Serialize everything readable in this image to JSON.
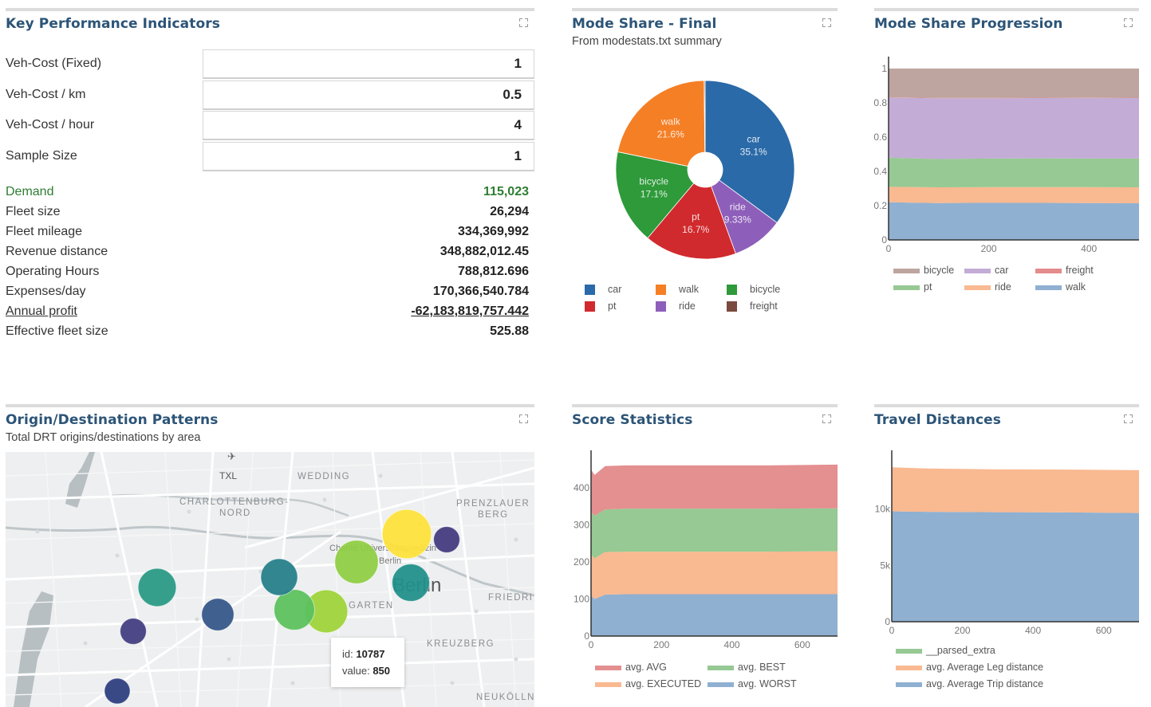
{
  "kpi": {
    "title": "Key Performance Indicators",
    "params": [
      {
        "label": "Veh-Cost (Fixed)",
        "value": "1"
      },
      {
        "label": "Veh-Cost / km",
        "value": "0.5"
      },
      {
        "label": "Veh-Cost / hour",
        "value": "4"
      },
      {
        "label": "Sample Size",
        "value": "1"
      }
    ],
    "metrics": [
      {
        "label": "Demand",
        "value": "115,023",
        "style": "green"
      },
      {
        "label": "Fleet size",
        "value": "26,294",
        "style": ""
      },
      {
        "label": "Fleet mileage",
        "value": "334,369,992",
        "style": ""
      },
      {
        "label": "Revenue distance",
        "value": "348,882,012.45",
        "style": ""
      },
      {
        "label": "Operating Hours",
        "value": "788,812.696",
        "style": ""
      },
      {
        "label": "Expenses/day",
        "value": "170,366,540.784",
        "style": ""
      },
      {
        "label": "Annual profit",
        "value": "-62,183,819,757.442",
        "style": "link"
      },
      {
        "label": "Effective fleet size",
        "value": "525.88",
        "style": ""
      }
    ]
  },
  "od": {
    "title": "Origin/Destination Patterns",
    "subtitle": "Total DRT origins/destinations by area",
    "map_labels": [
      "TXL",
      "WEDDING",
      "CHARLOTTENBURG-",
      "NORD",
      "PRENZLAUER",
      "BERG",
      "Berlin",
      "FRIEDRI",
      "KREUZBERG",
      "NEUKÖLLN",
      "GARTEN",
      "Charité Universitätsmedizin",
      "Berlin"
    ],
    "tooltip": {
      "id_label": "id:",
      "id": "10787",
      "value_label": "value:",
      "value": "850"
    }
  },
  "chart_data": [
    {
      "type": "pie",
      "title": "Mode Share - Final",
      "subtitle": "From modestats.txt summary",
      "slices": [
        {
          "label": "car",
          "value": 35.1,
          "text": "35.1%",
          "color": "#2a6aa8"
        },
        {
          "label": "ride",
          "value": 9.33,
          "text": "9.33%",
          "color": "#8e5fba"
        },
        {
          "label": "pt",
          "value": 16.7,
          "text": "16.7%",
          "color": "#d12a2e"
        },
        {
          "label": "bicycle",
          "value": 17.1,
          "text": "17.1%",
          "color": "#2e9a3a"
        },
        {
          "label": "walk",
          "value": 21.6,
          "text": "21.6%",
          "color": "#f57f25"
        },
        {
          "label": "freight",
          "value": 0.17,
          "text": "",
          "color": "#7b4a3f"
        }
      ],
      "legend": [
        {
          "label": "car",
          "color": "#2a6aa8"
        },
        {
          "label": "walk",
          "color": "#f57f25"
        },
        {
          "label": "bicycle",
          "color": "#2e9a3a"
        },
        {
          "label": "pt",
          "color": "#d12a2e"
        },
        {
          "label": "ride",
          "color": "#8e5fba"
        },
        {
          "label": "freight",
          "color": "#7b4a3f"
        }
      ]
    },
    {
      "type": "area",
      "title": "Mode Share Progression",
      "stacked": true,
      "x": [
        0,
        100,
        200,
        300,
        400,
        500
      ],
      "xlim": [
        0,
        500
      ],
      "ylim": [
        0,
        1
      ],
      "xticks": [
        0,
        200,
        400
      ],
      "yticks": [
        0,
        0.2,
        0.4,
        0.6,
        0.8,
        1
      ],
      "ytick_labels": [
        "0",
        "0.2",
        "0.4",
        "0.6",
        "0.8",
        "1"
      ],
      "series": [
        {
          "name": "walk",
          "color": "#8fb0d1",
          "values": [
            0.22,
            0.215,
            0.217,
            0.216,
            0.215,
            0.214
          ]
        },
        {
          "name": "ride",
          "color": "#f9b991",
          "values": [
            0.09,
            0.092,
            0.091,
            0.092,
            0.093,
            0.093
          ]
        },
        {
          "name": "pt",
          "color": "#96c993",
          "values": [
            0.17,
            0.165,
            0.167,
            0.168,
            0.167,
            0.168
          ]
        },
        {
          "name": "car",
          "color": "#c3acd5",
          "values": [
            0.35,
            0.355,
            0.352,
            0.352,
            0.354,
            0.353
          ]
        },
        {
          "name": "freight",
          "color": "#e48b8c",
          "values": [
            0.002,
            0.002,
            0.002,
            0.002,
            0.002,
            0.002
          ]
        },
        {
          "name": "bicycle",
          "color": "#bea59f",
          "values": [
            0.168,
            0.171,
            0.171,
            0.17,
            0.169,
            0.17
          ]
        }
      ],
      "legend": [
        {
          "label": "bicycle",
          "color": "#bea59f"
        },
        {
          "label": "car",
          "color": "#c3acd5"
        },
        {
          "label": "freight",
          "color": "#e48b8c"
        },
        {
          "label": "pt",
          "color": "#96c993"
        },
        {
          "label": "ride",
          "color": "#f9b991"
        },
        {
          "label": "walk",
          "color": "#8fb0d1"
        }
      ]
    },
    {
      "type": "area",
      "title": "Score Statistics",
      "stacked": true,
      "x": [
        0,
        10,
        40,
        100,
        300,
        500,
        700
      ],
      "xlim": [
        0,
        700
      ],
      "ylim": [
        0,
        480
      ],
      "xticks": [
        0,
        200,
        400,
        600
      ],
      "yticks": [
        0,
        100,
        200,
        300,
        400
      ],
      "ytick_labels": [
        "0",
        "100",
        "200",
        "300",
        "400"
      ],
      "series": [
        {
          "name": "avg. WORST",
          "color": "#8fb0d1",
          "values": [
            110,
            100,
            112,
            113,
            113,
            113,
            113
          ]
        },
        {
          "name": "avg. EXECUTED",
          "color": "#f9b991",
          "values": [
            110,
            110,
            115,
            115,
            115,
            115,
            116
          ]
        },
        {
          "name": "avg. BEST",
          "color": "#96c993",
          "values": [
            115,
            115,
            115,
            116,
            116,
            116,
            116
          ]
        },
        {
          "name": "avg. AVG",
          "color": "#e48f90",
          "values": [
            115,
            110,
            117,
            117,
            117,
            117,
            118
          ]
        }
      ],
      "legend": [
        {
          "label": "avg. AVG",
          "color": "#e48f90"
        },
        {
          "label": "avg. BEST",
          "color": "#96c993"
        },
        {
          "label": "avg. EXECUTED",
          "color": "#f9b991"
        },
        {
          "label": "avg. WORST",
          "color": "#8fb0d1"
        }
      ]
    },
    {
      "type": "area",
      "title": "Travel Distances",
      "stacked": true,
      "x": [
        0,
        100,
        300,
        500,
        700
      ],
      "xlim": [
        0,
        700
      ],
      "ylim": [
        0,
        14500
      ],
      "xticks": [
        0,
        200,
        400,
        600
      ],
      "yticks": [
        0,
        5000,
        10000
      ],
      "ytick_labels": [
        "0",
        "5k",
        "10k"
      ],
      "series": [
        {
          "name": "avg. Average Trip distance",
          "color": "#8fb0d1",
          "values": [
            9800,
            9750,
            9720,
            9700,
            9650
          ]
        },
        {
          "name": "avg. Average Leg distance",
          "color": "#f9b991",
          "values": [
            3900,
            3850,
            3800,
            3800,
            3800
          ]
        },
        {
          "name": "__parsed_extra",
          "color": "#96c993",
          "values": [
            0,
            0,
            0,
            0,
            0
          ]
        }
      ],
      "legend": [
        {
          "label": "__parsed_extra",
          "color": "#96c993"
        },
        {
          "label": "avg. Average Leg distance",
          "color": "#f9b991"
        },
        {
          "label": "avg. Average Trip distance",
          "color": "#8fb0d1"
        }
      ]
    }
  ],
  "bubbles": [
    {
      "value": 850,
      "color": "#fde13b",
      "cx": 0
    },
    {
      "value": 620,
      "color": "#8fcd45"
    },
    {
      "value": 600,
      "color": "#9ed33b"
    },
    {
      "value": 520,
      "color": "#5cc15e"
    },
    {
      "value": 440,
      "color": "#2a9a86"
    },
    {
      "value": 420,
      "color": "#22908a"
    },
    {
      "value": 400,
      "color": "#267f8a"
    },
    {
      "value": 280,
      "color": "#36578a"
    },
    {
      "value": 150,
      "color": "#453b80"
    },
    {
      "value": 150,
      "color": "#433f82"
    },
    {
      "value": 140,
      "color": "#2e3f80"
    }
  ],
  "ui": {
    "expand_icon": "expand-icon"
  }
}
